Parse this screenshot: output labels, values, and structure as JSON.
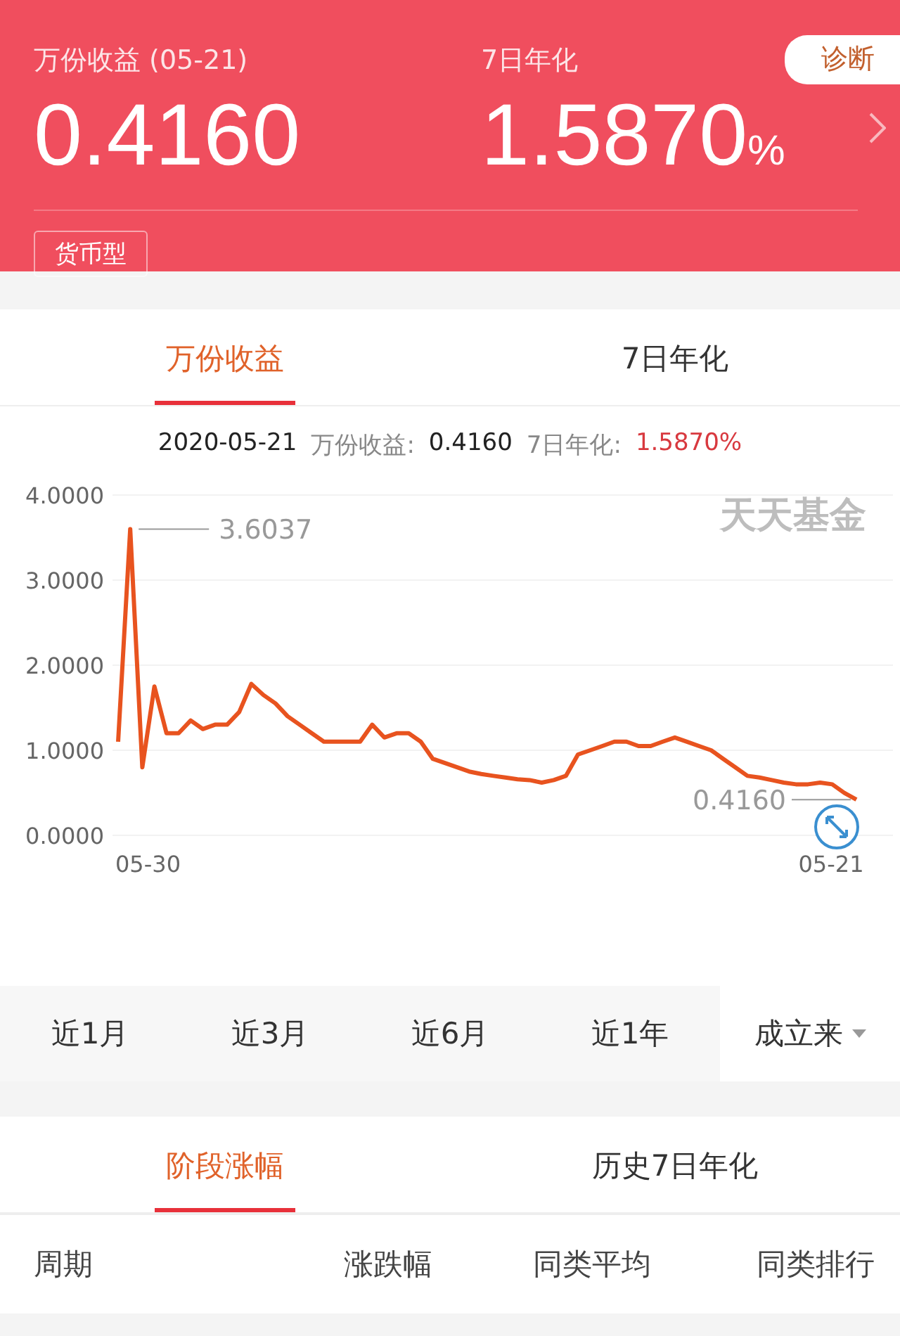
{
  "header": {
    "yield_label": "万份收益 (05-21)",
    "yield_value": "0.4160",
    "annual_label": "7日年化",
    "annual_value": "1.5870",
    "annual_unit": "%",
    "diagnose_button": "诊断",
    "fund_type_tag": "货币型"
  },
  "chart_tabs": [
    {
      "label": "万份收益",
      "selected": true
    },
    {
      "label": "7日年化",
      "selected": false
    }
  ],
  "info_line": {
    "date": "2020-05-21",
    "yield_label": "万份收益:",
    "yield_value": "0.4160",
    "annual_label": "7日年化:",
    "annual_value": "1.5870%"
  },
  "chart": {
    "watermark": "天天基金",
    "start_label": "05-30",
    "end_label": "05-21",
    "chart_data": {
      "type": "line",
      "grid": true,
      "ylim": [
        0,
        4
      ],
      "yticks": [
        {
          "value": 0,
          "label": "0.0000"
        },
        {
          "value": 1,
          "label": "1.0000"
        },
        {
          "value": 2,
          "label": "2.0000"
        },
        {
          "value": 3,
          "label": "3.0000"
        },
        {
          "value": 4,
          "label": "4.0000"
        }
      ],
      "series": [
        {
          "color": "#e8531f",
          "values": [
            1.1,
            3.6,
            0.8,
            1.75,
            1.2,
            1.2,
            1.35,
            1.25,
            1.3,
            1.3,
            1.45,
            1.78,
            1.65,
            1.55,
            1.4,
            1.3,
            1.2,
            1.1,
            1.1,
            1.1,
            1.1,
            1.3,
            1.15,
            1.2,
            1.2,
            1.1,
            0.9,
            0.85,
            0.8,
            0.75,
            0.72,
            0.7,
            0.68,
            0.66,
            0.65,
            0.62,
            0.65,
            0.7,
            0.95,
            1.0,
            1.05,
            1.1,
            1.1,
            1.05,
            1.05,
            1.1,
            1.15,
            1.1,
            1.05,
            1.0,
            0.9,
            0.8,
            0.7,
            0.68,
            0.65,
            0.62,
            0.6,
            0.6,
            0.62,
            0.6,
            0.5,
            0.42
          ]
        }
      ],
      "annotations": [
        {
          "text": "3.6037"
        },
        {
          "text": "0.4160"
        }
      ]
    }
  },
  "ranges": [
    {
      "label": "近1月",
      "selected": false
    },
    {
      "label": "近3月",
      "selected": false
    },
    {
      "label": "近6月",
      "selected": false
    },
    {
      "label": "近1年",
      "selected": false
    },
    {
      "label": "成立来",
      "selected": true
    }
  ],
  "period_tabs": [
    {
      "label": "阶段涨幅",
      "selected": true
    },
    {
      "label": "历史7日年化",
      "selected": false
    }
  ],
  "table": {
    "columns": [
      "周期",
      "涨跌幅",
      "同类平均",
      "同类排行"
    ]
  }
}
